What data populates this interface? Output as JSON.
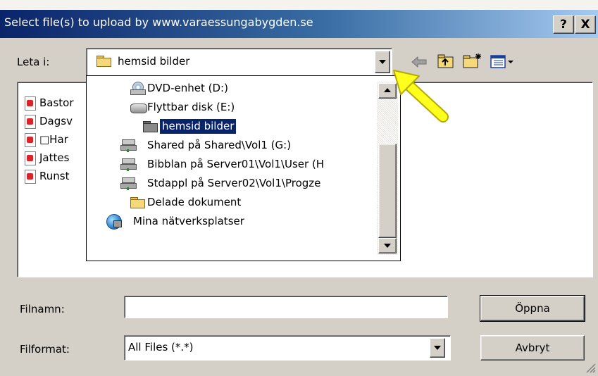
{
  "window": {
    "title": "Select file(s) to upload by www.varaessungabygden.se",
    "help_button": "?",
    "close_button": "X"
  },
  "toolbar": {
    "look_in_label": "Leta i:",
    "look_in_value": "hemsid bilder",
    "icons": [
      "back-arrow-icon",
      "up-folder-icon",
      "new-folder-icon",
      "view-menu-icon"
    ]
  },
  "dropdown": {
    "items": [
      {
        "label": "DVD-enhet (D:)",
        "icon": "dvd-drive-icon"
      },
      {
        "label": "Flyttbar disk (E:)",
        "icon": "removable-disk-icon"
      },
      {
        "label": "hemsid bilder",
        "icon": "folder-open-icon",
        "selected": true
      },
      {
        "label": "Shared på Shared\\Vol1 (G:)",
        "icon": "network-drive-icon"
      },
      {
        "label": "Bibblan på Server01\\Vol1\\User (H",
        "icon": "network-drive-icon"
      },
      {
        "label": "Stdappl på Server02\\Vol1\\Progze",
        "icon": "network-drive-icon"
      },
      {
        "label": "Delade dokument",
        "icon": "folder-icon"
      },
      {
        "label": "Mina nätverksplatser",
        "icon": "network-places-icon"
      }
    ]
  },
  "files": [
    {
      "name": "Bastor",
      "icon": "file-icon"
    },
    {
      "name": "Dagsv",
      "icon": "file-icon"
    },
    {
      "name": "□Har",
      "icon": "file-icon"
    },
    {
      "name": "Jattes",
      "icon": "file-icon"
    },
    {
      "name": "Runst",
      "icon": "file-icon"
    }
  ],
  "form": {
    "filename_label": "Filnamn:",
    "filename_value": "",
    "filetype_label": "Filformat:",
    "filetype_value": "All Files (*.*)",
    "open_button": "Öppna",
    "cancel_button": "Avbryt"
  },
  "colors": {
    "title_start": "#0a246a",
    "title_end": "#a6caf0",
    "selection": "#0a246a",
    "arrow_callout": "#ffff00"
  }
}
